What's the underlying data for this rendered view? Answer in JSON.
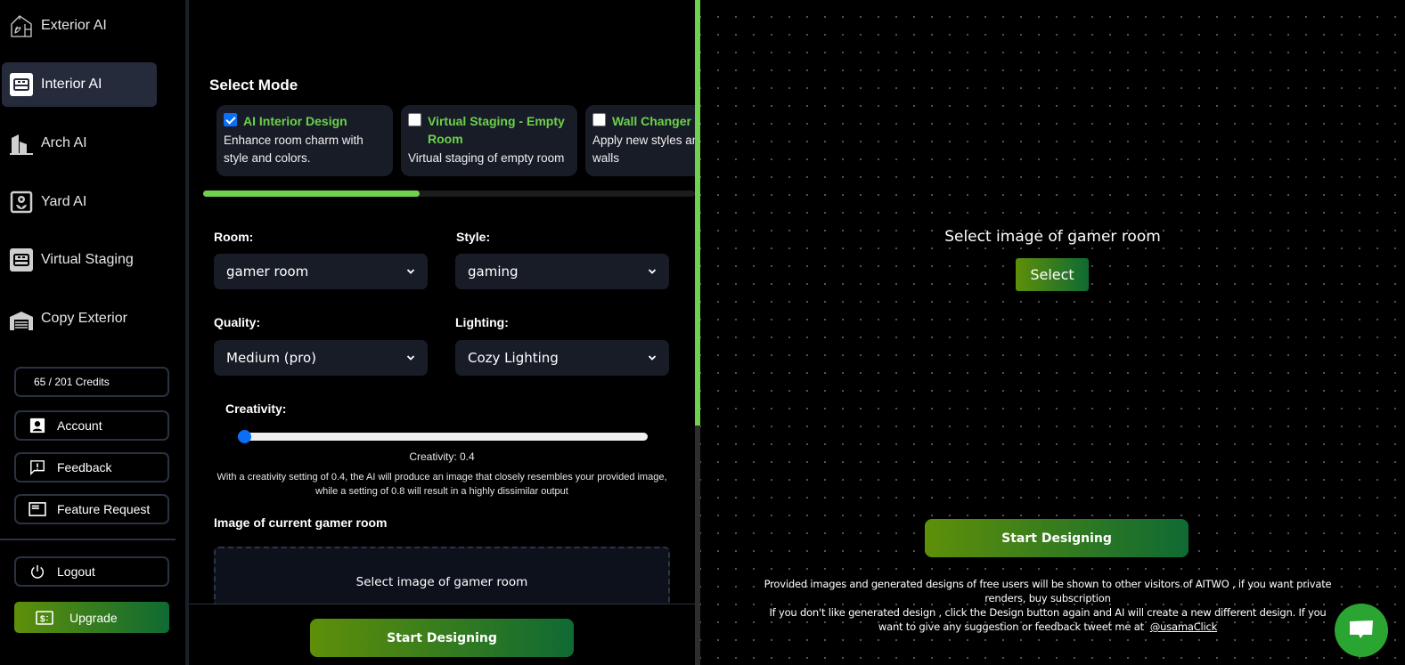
{
  "sidebar": {
    "nav": [
      {
        "label": "Exterior AI",
        "icon": "greenhouse-icon",
        "active": false
      },
      {
        "label": "Interior AI",
        "icon": "bed-icon",
        "active": true
      },
      {
        "label": "Arch AI",
        "icon": "buildings-icon",
        "active": false
      },
      {
        "label": "Yard AI",
        "icon": "flower-icon",
        "active": false
      },
      {
        "label": "Virtual Staging",
        "icon": "bed-icon",
        "active": false
      },
      {
        "label": "Copy Exterior",
        "icon": "garage-icon",
        "active": false
      }
    ],
    "credits": "65 / 201 Credits",
    "account": "Account",
    "feedback": "Feedback",
    "feature_request": "Feature Request",
    "logout": "Logout",
    "upgrade": "Upgrade"
  },
  "mode": {
    "title": "Select Mode",
    "cards": [
      {
        "title": "AI Interior Design",
        "desc": "Enhance room charm with style and colors.",
        "checked": true
      },
      {
        "title": "Virtual Staging - Empty Room",
        "desc": "Virtual staging of empty room",
        "checked": false
      },
      {
        "title": "Wall Changer",
        "desc": "Apply new styles and colors to walls",
        "checked": false
      }
    ],
    "scroll_progress": 0.44
  },
  "form": {
    "room_label": "Room:",
    "room_value": "gamer room",
    "style_label": "Style:",
    "style_value": "gaming",
    "quality_label": "Quality:",
    "quality_value": "Medium (pro)",
    "lighting_label": "Lighting:",
    "lighting_value": "Cozy Lighting",
    "creativity_label": "Creativity:",
    "creativity_value": 0.4,
    "creativity_min": 0.4,
    "creativity_max": 0.8,
    "creativity_readout": "Creativity: 0.4",
    "creativity_help": "With a creativity setting of 0.4, the AI will produce an image that closely resembles your provided image, while a setting of 0.8 will result in a highly dissimilar output",
    "image_label": "Image of current gamer room",
    "dropzone_text": "Select image of gamer room",
    "start_button": "Start Designing"
  },
  "page_scroll_progress": 0.64,
  "preview": {
    "prompt": "Select image of gamer room",
    "select_button": "Select",
    "start_button": "Start Designing",
    "notice_line1": "Provided images and generated designs of free users will be shown to other visitors of AITWO , if you want private renders, buy subscription",
    "notice_line2": "If you don't like generated design , click the Design button again and AI will create a new different design. If you want to give any suggestion or feedback tweet me at",
    "twitter_handle": "@usamaClick",
    "chat_icon": "chat-bubble-icon"
  },
  "colors": {
    "accent_green": "#6fd14d",
    "gradient_start": "#5e8f09",
    "gradient_end": "#0f6a33",
    "checkbox_blue": "#0b6ff5",
    "card_bg": "#181c27",
    "chat_green": "#2ba532"
  }
}
